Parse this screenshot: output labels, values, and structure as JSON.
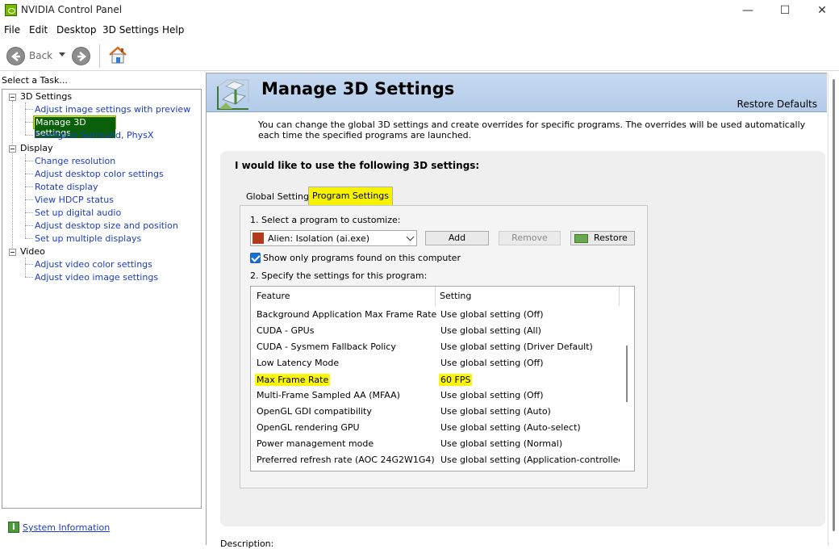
{
  "window": {
    "title": "NVIDIA Control Panel",
    "minimize_glyph": "—",
    "maximize_glyph": "☐",
    "close_glyph": "✕"
  },
  "menu": [
    "File",
    "Edit",
    "Desktop",
    "3D Settings",
    "Help"
  ],
  "toolbar": {
    "back_label": "Back",
    "icons": [
      "back-arrow-icon",
      "forward-arrow-icon",
      "home-icon"
    ]
  },
  "sidebar": {
    "task_label": "Select a Task...",
    "groups": [
      {
        "label": "3D Settings",
        "items": [
          "Adjust image settings with preview",
          "Manage 3D settings",
          "Configure Surround, PhysX"
        ]
      },
      {
        "label": "Display",
        "items": [
          "Change resolution",
          "Adjust desktop color settings",
          "Rotate display",
          "View HDCP status",
          "Set up digital audio",
          "Adjust desktop size and position",
          "Set up multiple displays"
        ]
      },
      {
        "label": "Video",
        "items": [
          "Adjust video color settings",
          "Adjust video image settings"
        ]
      }
    ],
    "selected_item": "Manage 3D settings",
    "system_information": "System Information"
  },
  "main": {
    "title": "Manage 3D Settings",
    "restore_defaults": "Restore Defaults",
    "description": "You can change the global 3D settings and create overrides for specific programs. The overrides will be used automatically each time the specified programs are launched.",
    "panel_heading": "I would like to use the following 3D settings:",
    "tabs": [
      {
        "label": "Global Settings",
        "active": false
      },
      {
        "label": "Program Settings",
        "active": true
      }
    ],
    "step1_label": "1. Select a program to customize:",
    "program_selected": "Alien: Isolation (ai.exe)",
    "add_button": "Add",
    "remove_button": "Remove",
    "restore_button": "Restore",
    "checkbox_label": "Show only programs found on this computer",
    "checkbox_checked": true,
    "step2_label": "2. Specify the settings for this program:",
    "columns": [
      "Feature",
      "Setting"
    ],
    "rows": [
      {
        "feature": "Background Application Max Frame Rate",
        "setting": "Use global setting (Off)"
      },
      {
        "feature": "CUDA - GPUs",
        "setting": "Use global setting (All)"
      },
      {
        "feature": "CUDA - Sysmem Fallback Policy",
        "setting": "Use global setting (Driver Default)"
      },
      {
        "feature": "Low Latency Mode",
        "setting": "Use global setting (Off)"
      },
      {
        "feature": "Max Frame Rate",
        "setting": "60 FPS"
      },
      {
        "feature": "Multi-Frame Sampled AA (MFAA)",
        "setting": "Use global setting (Off)"
      },
      {
        "feature": "OpenGL GDI compatibility",
        "setting": "Use global setting (Auto)"
      },
      {
        "feature": "OpenGL rendering GPU",
        "setting": "Use global setting (Auto-select)"
      },
      {
        "feature": "Power management mode",
        "setting": "Use global setting (Normal)"
      },
      {
        "feature": "Preferred refresh rate (AOC 24G2W1G4)",
        "setting": "Use global setting (Application-controlled)"
      }
    ],
    "highlighted_row": "Max Frame Rate",
    "description_label": "Description:"
  },
  "colors": {
    "highlight": "#fbf60a",
    "nvidia_green": "#76b900",
    "link": "#1a3cc8",
    "banner": "#c6d9f1"
  }
}
